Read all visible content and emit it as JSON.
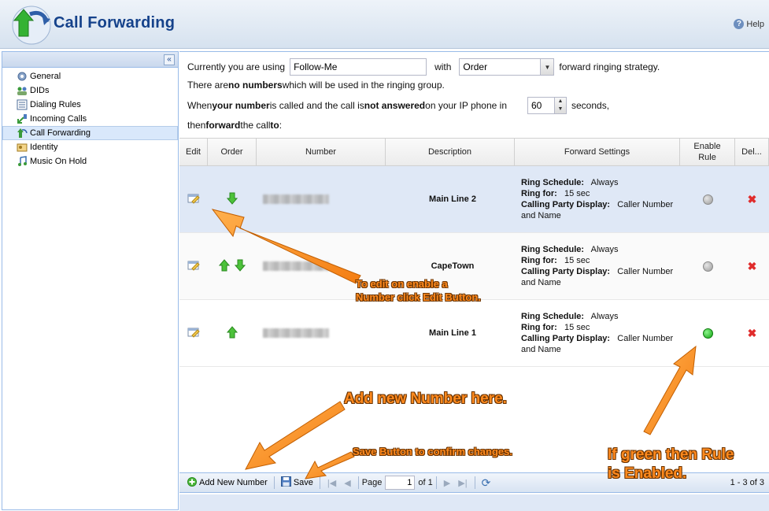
{
  "header": {
    "title": "Call Forwarding",
    "help_label": "Help"
  },
  "sidebar": {
    "collapse_label": "«",
    "items": [
      {
        "label": "General",
        "icon": "gear-icon"
      },
      {
        "label": "DIDs",
        "icon": "people-icon"
      },
      {
        "label": "Dialing Rules",
        "icon": "rules-icon"
      },
      {
        "label": "Incoming Calls",
        "icon": "incoming-call-icon"
      },
      {
        "label": "Call Forwarding",
        "icon": "call-forwarding-icon"
      },
      {
        "label": "Identity",
        "icon": "identity-icon"
      },
      {
        "label": "Music On Hold",
        "icon": "music-icon"
      }
    ]
  },
  "form": {
    "using_prefix": "Currently you are using",
    "strategy_value": "Follow-Me",
    "with_label": "with",
    "order_value": "Order",
    "strategy_suffix": "forward ringing strategy.",
    "line2_a": "There are ",
    "line2_b": "no numbers",
    "line2_c": " which will be used in the ringing group.",
    "line3_a": "When ",
    "line3_b": "your number",
    "line3_c": " is called and the call is ",
    "line3_d": "not answered",
    "line3_e": " on your IP phone in",
    "seconds_value": "60",
    "seconds_suffix": "seconds,",
    "line4_a": "then ",
    "line4_b": "forward",
    "line4_c": " the call ",
    "line4_d": "to",
    "line4_e": " :"
  },
  "grid": {
    "columns": {
      "edit": "Edit",
      "order": "Order",
      "number": "Number",
      "description": "Description",
      "forward_settings": "Forward Settings",
      "enable_rule_1": "Enable",
      "enable_rule_2": "Rule",
      "delete": "Del..."
    },
    "labels": {
      "ring_schedule": "Ring Schedule:",
      "ring_for": "Ring for:",
      "calling_party": "Calling Party Display:"
    },
    "rows": [
      {
        "description": "Main Line 2",
        "ring_schedule": "Always",
        "ring_for": "15 sec",
        "calling_party_a": "Caller Number",
        "calling_party_b": "and Name",
        "enabled": false
      },
      {
        "description": "CapeTown",
        "ring_schedule": "Always",
        "ring_for": "15 sec",
        "calling_party_a": "Caller Number",
        "calling_party_b": "and Name",
        "enabled": false
      },
      {
        "description": "Main Line 1",
        "ring_schedule": "Always",
        "ring_for": "15 sec",
        "calling_party_a": "Caller Number",
        "calling_party_b": "and Name",
        "enabled": true
      }
    ]
  },
  "toolbar": {
    "add_label": "Add New Number",
    "save_label": "Save",
    "page_label": "Page",
    "page_value": "1",
    "of_label": "of 1",
    "count_label": "1 - 3 of 3"
  },
  "annotations": {
    "edit_1": "To edit on enable a",
    "edit_2": "Number click Edit Button.",
    "add": "Add new Number here.",
    "save": "Save Button to confirm changes.",
    "green_1": "If green then Rule",
    "green_2": "is Enabled."
  },
  "colors": {
    "accent": "#15428b",
    "annotation": "#ff8a1e",
    "enabled": "#12a312",
    "delete": "#e02c2c"
  }
}
